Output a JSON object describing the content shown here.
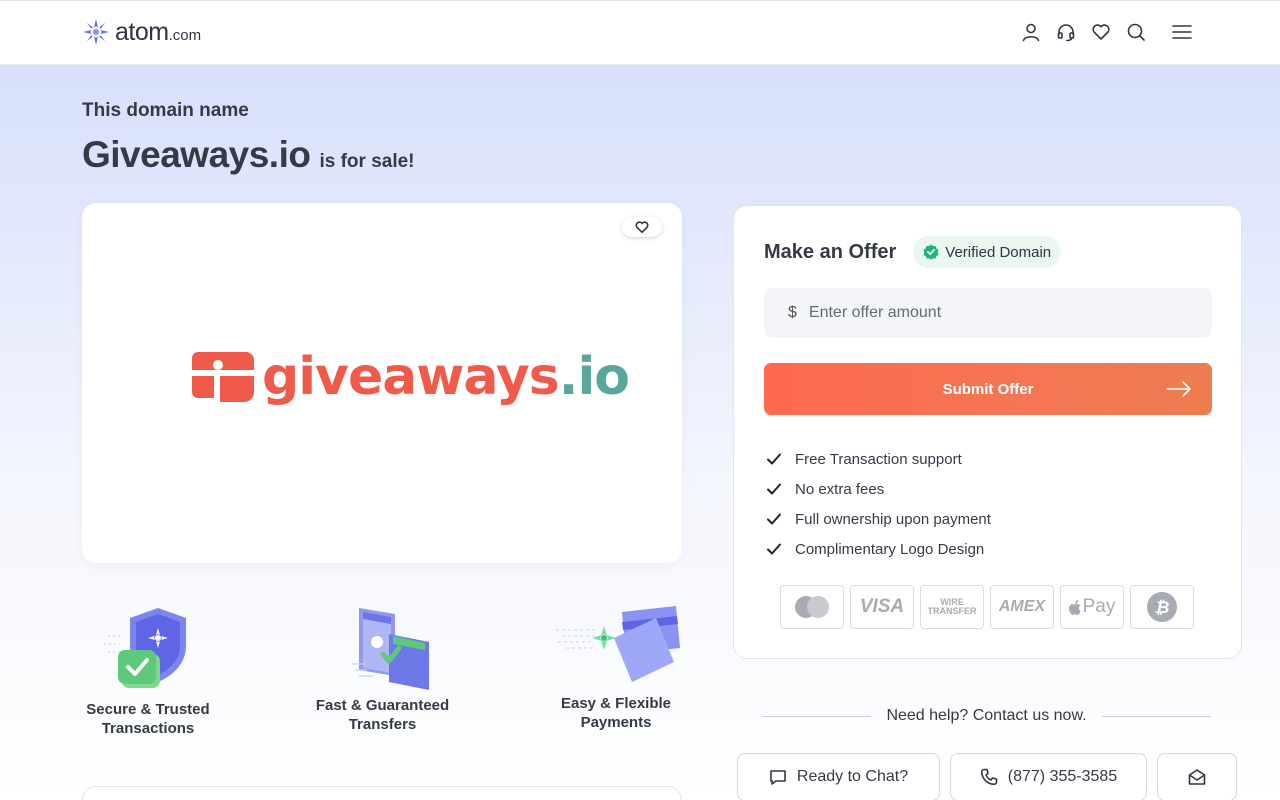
{
  "header": {
    "logo_text": "atom",
    "logo_suffix": ".com",
    "icons": [
      "user-icon",
      "headset-icon",
      "heart-icon",
      "search-icon",
      "menu-icon"
    ]
  },
  "hero": {
    "pre_title": "This domain name",
    "domain": "Giveaways.io",
    "suffix": "is for sale!"
  },
  "logo_card": {
    "brand_name": "giveaways",
    "brand_tld": ".io",
    "brand_colors": {
      "primary": "#ef5a4b",
      "tld": "#5aa69d"
    }
  },
  "features": [
    {
      "line1": "Secure & Trusted",
      "line2": "Transactions",
      "icon": "shield-check-icon"
    },
    {
      "line1": "Fast & Guaranteed",
      "line2": "Transfers",
      "icon": "transfer-icon"
    },
    {
      "line1": "Easy & Flexible",
      "line2": "Payments",
      "icon": "cards-icon"
    }
  ],
  "offer": {
    "title": "Make an Offer",
    "verified_label": "Verified Domain",
    "currency_symbol": "$",
    "input_placeholder": "Enter offer amount",
    "input_value": "",
    "submit_label": "Submit Offer",
    "benefits": [
      "Free Transaction support",
      "No extra fees",
      "Full ownership upon payment",
      "Complimentary Logo Design"
    ],
    "payment_methods": [
      "mastercard-icon",
      "VISA",
      "WIRE TRANSFER",
      "AMEX",
      "Pay",
      "bitcoin-icon"
    ]
  },
  "help": {
    "text": "Need help? Contact us now.",
    "chat_label": "Ready to Chat?",
    "phone_label": "(877) 355-3585"
  },
  "colors": {
    "accent_gradient_start": "#fd6a4e",
    "accent_gradient_end": "#ee7c4f",
    "verified_green": "#1fb57a",
    "logo_purple": "#5e64e8"
  }
}
